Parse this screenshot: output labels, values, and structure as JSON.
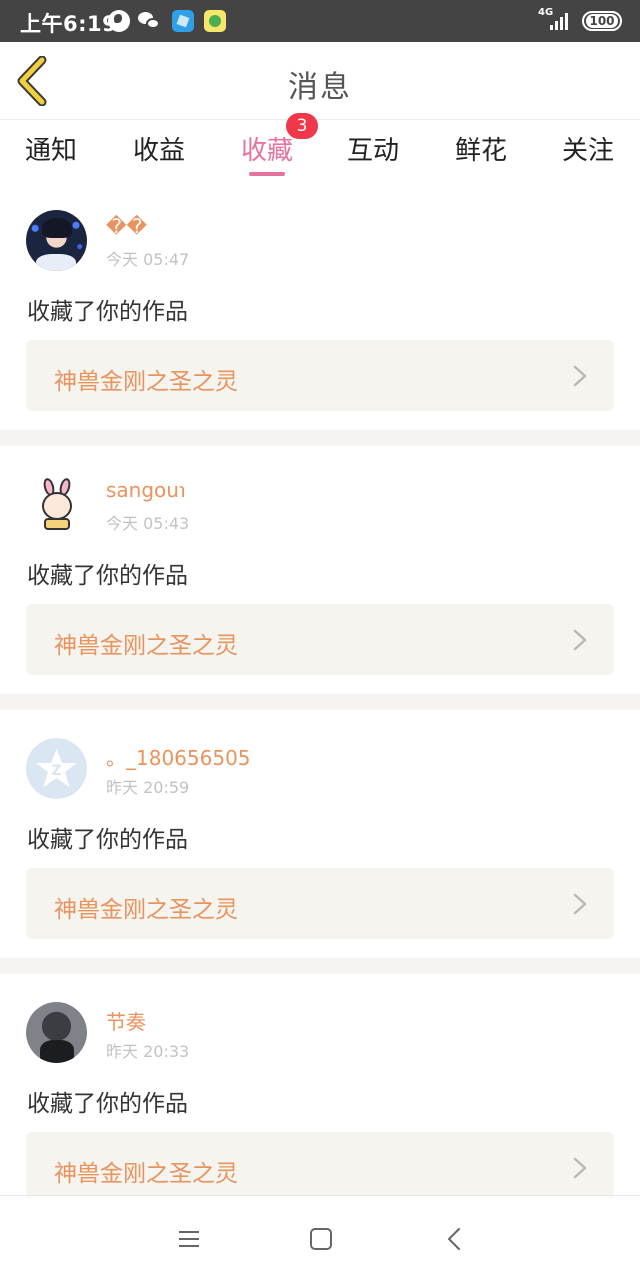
{
  "status_bar": {
    "time": "上午6:19",
    "network": "4G",
    "battery": "100"
  },
  "header": {
    "title": "消息",
    "back_icon": "chevron-left-icon",
    "accent_color": "#c9a52a"
  },
  "tabs": {
    "items": [
      {
        "label": "通知"
      },
      {
        "label": "收益"
      },
      {
        "label": "收藏",
        "badge": "3"
      },
      {
        "label": "互动"
      },
      {
        "label": "鲜花"
      },
      {
        "label": "关注"
      }
    ],
    "active_color": "#e6729f",
    "badge_color": "#f0384a"
  },
  "feed": {
    "items": [
      {
        "username": "��",
        "time": "今天 05:47",
        "action": "收藏了你的作品",
        "work": "神兽金刚之圣之灵"
      },
      {
        "username": "sangou℩",
        "time": "今天 05:43",
        "action": "收藏了你的作品",
        "work": "神兽金刚之圣之灵"
      },
      {
        "username": "。_180656505",
        "time": "昨天 20:59",
        "action": "收藏了你的作品",
        "work": "神兽金刚之圣之灵"
      },
      {
        "username": "节奏",
        "time": "昨天 20:33",
        "action": "收藏了你的作品",
        "work": "神兽金刚之圣之灵"
      }
    ],
    "name_color": "#e9935e"
  },
  "navbar": {
    "icons": [
      "menu-icon",
      "home-square-icon",
      "back-arrow-icon"
    ]
  }
}
